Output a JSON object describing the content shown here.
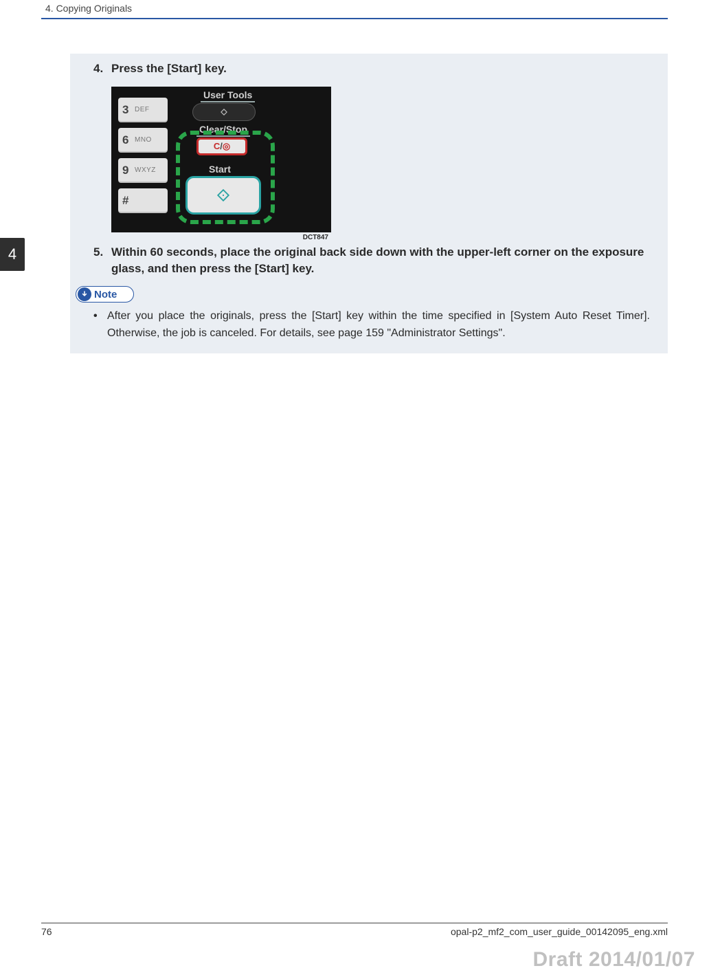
{
  "header": {
    "chapter_heading": "4. Copying Originals",
    "side_tab": "4"
  },
  "steps": {
    "s4": {
      "num": "4.",
      "text": "Press the [Start] key."
    },
    "s5": {
      "num": "5.",
      "text": "Within 60 seconds, place the original back side down with the upper-left corner on the exposure glass, and then press the [Start] key."
    }
  },
  "panel": {
    "keys": [
      {
        "digit": "3",
        "letters": "DEF"
      },
      {
        "digit": "6",
        "letters": "MNO"
      },
      {
        "digit": "9",
        "letters": "WXYZ"
      },
      {
        "digit": "#",
        "letters": ""
      }
    ],
    "label_user_tools": "User Tools",
    "label_clear_stop": "Clear/Stop",
    "label_start": "Start",
    "clearstop_c": "C",
    "clearstop_slash": "/",
    "clearstop_stop": "◎",
    "image_code": "DCT847"
  },
  "note": {
    "label": "Note",
    "bullet": "•",
    "text": "After you place the originals, press the [Start] key within the time specified in [System Auto Reset Timer]. Otherwise, the job is canceled. For details, see page 159 \"Administrator Settings\"."
  },
  "footer": {
    "page_number": "76",
    "filename": "opal-p2_mf2_com_user_guide_00142095_eng.xml",
    "draft": "Draft 2014/01/07"
  }
}
